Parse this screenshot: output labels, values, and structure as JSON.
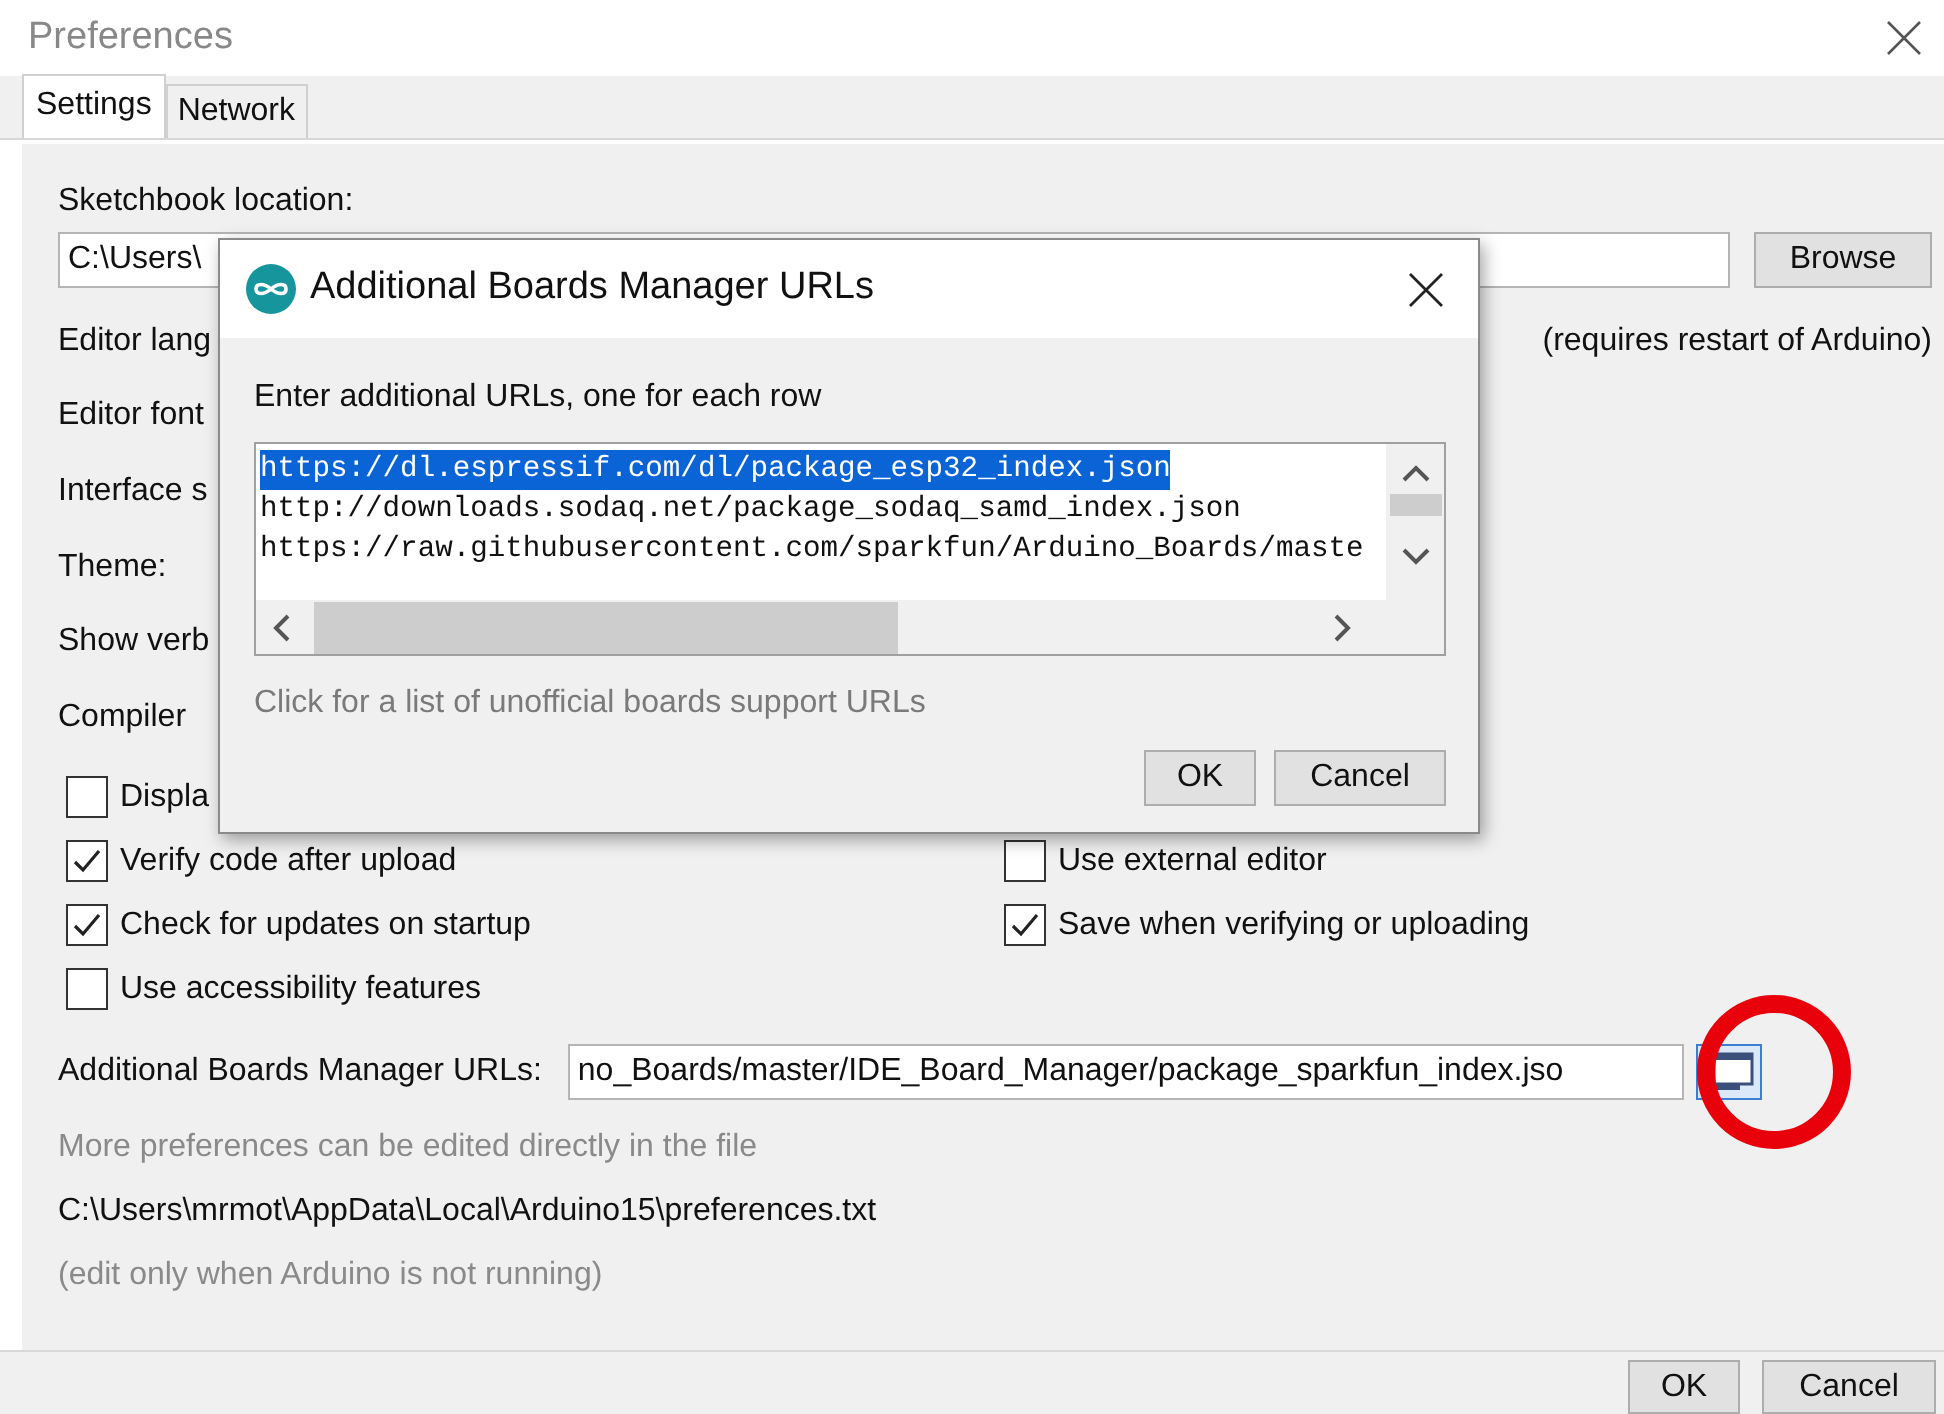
{
  "window": {
    "title": "Preferences"
  },
  "tabs": [
    {
      "label": "Settings",
      "selected": true
    },
    {
      "label": "Network",
      "selected": false
    }
  ],
  "settings": {
    "sketchbook_label": "Sketchbook location:",
    "sketchbook_value": "C:\\Users\\",
    "browse_button": "Browse",
    "option_labels": [
      "Editor lang",
      "Editor font",
      "Interface s",
      "Theme:",
      "Show verb",
      "Compiler"
    ],
    "restart_note": "(requires restart of Arduino)",
    "checkbox_rows": [
      {
        "left": {
          "label": "Displa",
          "checked": false
        }
      },
      {
        "left": {
          "label": "Verify code after upload",
          "checked": true
        },
        "right": {
          "label": "Use external editor",
          "checked": false
        }
      },
      {
        "left": {
          "label": "Check for updates on startup",
          "checked": true
        },
        "right": {
          "label": "Save when verifying or uploading",
          "checked": true
        }
      },
      {
        "left": {
          "label": "Use accessibility features",
          "checked": false
        }
      }
    ],
    "urls_label": "Additional Boards Manager URLs:",
    "urls_value": "no_Boards/master/IDE_Board_Manager/package_sparkfun_index.jso",
    "more_note": "More preferences can be edited directly in the file",
    "prefs_path": "C:\\Users\\mrmot\\AppData\\Local\\Arduino15\\preferences.txt",
    "edit_note": "(edit only when Arduino is not running)"
  },
  "buttons": [
    "OK",
    "Cancel"
  ],
  "dialog": {
    "title": "Additional Boards Manager URLs",
    "prompt": "Enter additional URLs, one for each row",
    "urls": [
      {
        "text": "https://dl.espressif.com/dl/package_esp32_index.json",
        "selected": true
      },
      {
        "text": "http://downloads.sodaq.net/package_sodaq_samd_index.json",
        "selected": false
      },
      {
        "text": "https://raw.githubusercontent.com/sparkfun/Arduino_Boards/maste",
        "selected": false
      }
    ],
    "link": "Click for a list of unofficial boards support URLs",
    "buttons": [
      "OK",
      "Cancel"
    ]
  }
}
